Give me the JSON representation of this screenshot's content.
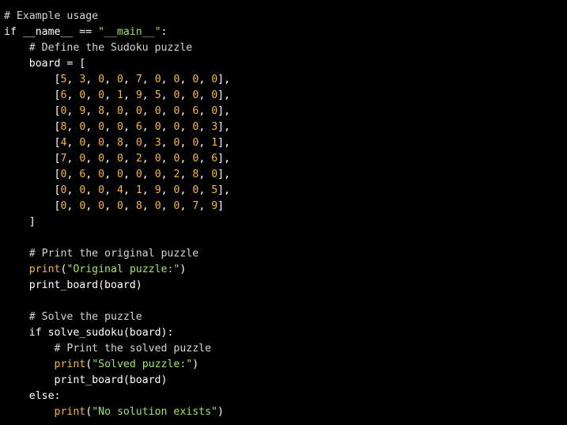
{
  "theme": {
    "background": "#000000",
    "comment": "#d4d4d4",
    "keyword": "#ffffff",
    "builtin": "#f5b83d",
    "string": "#9ee66a",
    "number": "#f5b83d",
    "plain": "#ffffff"
  },
  "code": {
    "lines": [
      [
        {
          "t": "comment",
          "v": "# Example usage"
        }
      ],
      [
        {
          "t": "keyword",
          "v": "if"
        },
        {
          "t": "plain",
          "v": " __name__ == "
        },
        {
          "t": "string",
          "v": "\"__main__\""
        },
        {
          "t": "plain",
          "v": ":"
        }
      ],
      [
        {
          "t": "plain",
          "v": "    "
        },
        {
          "t": "comment",
          "v": "# Define the Sudoku puzzle"
        }
      ],
      [
        {
          "t": "plain",
          "v": "    board = ["
        }
      ],
      [
        {
          "t": "plain",
          "v": "        ["
        },
        {
          "t": "number",
          "v": "5"
        },
        {
          "t": "plain",
          "v": ", "
        },
        {
          "t": "number",
          "v": "3"
        },
        {
          "t": "plain",
          "v": ", "
        },
        {
          "t": "number",
          "v": "0"
        },
        {
          "t": "plain",
          "v": ", "
        },
        {
          "t": "number",
          "v": "0"
        },
        {
          "t": "plain",
          "v": ", "
        },
        {
          "t": "number",
          "v": "7"
        },
        {
          "t": "plain",
          "v": ", "
        },
        {
          "t": "number",
          "v": "0"
        },
        {
          "t": "plain",
          "v": ", "
        },
        {
          "t": "number",
          "v": "0"
        },
        {
          "t": "plain",
          "v": ", "
        },
        {
          "t": "number",
          "v": "0"
        },
        {
          "t": "plain",
          "v": ", "
        },
        {
          "t": "number",
          "v": "0"
        },
        {
          "t": "plain",
          "v": "],"
        }
      ],
      [
        {
          "t": "plain",
          "v": "        ["
        },
        {
          "t": "number",
          "v": "6"
        },
        {
          "t": "plain",
          "v": ", "
        },
        {
          "t": "number",
          "v": "0"
        },
        {
          "t": "plain",
          "v": ", "
        },
        {
          "t": "number",
          "v": "0"
        },
        {
          "t": "plain",
          "v": ", "
        },
        {
          "t": "number",
          "v": "1"
        },
        {
          "t": "plain",
          "v": ", "
        },
        {
          "t": "number",
          "v": "9"
        },
        {
          "t": "plain",
          "v": ", "
        },
        {
          "t": "number",
          "v": "5"
        },
        {
          "t": "plain",
          "v": ", "
        },
        {
          "t": "number",
          "v": "0"
        },
        {
          "t": "plain",
          "v": ", "
        },
        {
          "t": "number",
          "v": "0"
        },
        {
          "t": "plain",
          "v": ", "
        },
        {
          "t": "number",
          "v": "0"
        },
        {
          "t": "plain",
          "v": "],"
        }
      ],
      [
        {
          "t": "plain",
          "v": "        ["
        },
        {
          "t": "number",
          "v": "0"
        },
        {
          "t": "plain",
          "v": ", "
        },
        {
          "t": "number",
          "v": "9"
        },
        {
          "t": "plain",
          "v": ", "
        },
        {
          "t": "number",
          "v": "8"
        },
        {
          "t": "plain",
          "v": ", "
        },
        {
          "t": "number",
          "v": "0"
        },
        {
          "t": "plain",
          "v": ", "
        },
        {
          "t": "number",
          "v": "0"
        },
        {
          "t": "plain",
          "v": ", "
        },
        {
          "t": "number",
          "v": "0"
        },
        {
          "t": "plain",
          "v": ", "
        },
        {
          "t": "number",
          "v": "0"
        },
        {
          "t": "plain",
          "v": ", "
        },
        {
          "t": "number",
          "v": "6"
        },
        {
          "t": "plain",
          "v": ", "
        },
        {
          "t": "number",
          "v": "0"
        },
        {
          "t": "plain",
          "v": "],"
        }
      ],
      [
        {
          "t": "plain",
          "v": "        ["
        },
        {
          "t": "number",
          "v": "8"
        },
        {
          "t": "plain",
          "v": ", "
        },
        {
          "t": "number",
          "v": "0"
        },
        {
          "t": "plain",
          "v": ", "
        },
        {
          "t": "number",
          "v": "0"
        },
        {
          "t": "plain",
          "v": ", "
        },
        {
          "t": "number",
          "v": "0"
        },
        {
          "t": "plain",
          "v": ", "
        },
        {
          "t": "number",
          "v": "6"
        },
        {
          "t": "plain",
          "v": ", "
        },
        {
          "t": "number",
          "v": "0"
        },
        {
          "t": "plain",
          "v": ", "
        },
        {
          "t": "number",
          "v": "0"
        },
        {
          "t": "plain",
          "v": ", "
        },
        {
          "t": "number",
          "v": "0"
        },
        {
          "t": "plain",
          "v": ", "
        },
        {
          "t": "number",
          "v": "3"
        },
        {
          "t": "plain",
          "v": "],"
        }
      ],
      [
        {
          "t": "plain",
          "v": "        ["
        },
        {
          "t": "number",
          "v": "4"
        },
        {
          "t": "plain",
          "v": ", "
        },
        {
          "t": "number",
          "v": "0"
        },
        {
          "t": "plain",
          "v": ", "
        },
        {
          "t": "number",
          "v": "0"
        },
        {
          "t": "plain",
          "v": ", "
        },
        {
          "t": "number",
          "v": "8"
        },
        {
          "t": "plain",
          "v": ", "
        },
        {
          "t": "number",
          "v": "0"
        },
        {
          "t": "plain",
          "v": ", "
        },
        {
          "t": "number",
          "v": "3"
        },
        {
          "t": "plain",
          "v": ", "
        },
        {
          "t": "number",
          "v": "0"
        },
        {
          "t": "plain",
          "v": ", "
        },
        {
          "t": "number",
          "v": "0"
        },
        {
          "t": "plain",
          "v": ", "
        },
        {
          "t": "number",
          "v": "1"
        },
        {
          "t": "plain",
          "v": "],"
        }
      ],
      [
        {
          "t": "plain",
          "v": "        ["
        },
        {
          "t": "number",
          "v": "7"
        },
        {
          "t": "plain",
          "v": ", "
        },
        {
          "t": "number",
          "v": "0"
        },
        {
          "t": "plain",
          "v": ", "
        },
        {
          "t": "number",
          "v": "0"
        },
        {
          "t": "plain",
          "v": ", "
        },
        {
          "t": "number",
          "v": "0"
        },
        {
          "t": "plain",
          "v": ", "
        },
        {
          "t": "number",
          "v": "2"
        },
        {
          "t": "plain",
          "v": ", "
        },
        {
          "t": "number",
          "v": "0"
        },
        {
          "t": "plain",
          "v": ", "
        },
        {
          "t": "number",
          "v": "0"
        },
        {
          "t": "plain",
          "v": ", "
        },
        {
          "t": "number",
          "v": "0"
        },
        {
          "t": "plain",
          "v": ", "
        },
        {
          "t": "number",
          "v": "6"
        },
        {
          "t": "plain",
          "v": "],"
        }
      ],
      [
        {
          "t": "plain",
          "v": "        ["
        },
        {
          "t": "number",
          "v": "0"
        },
        {
          "t": "plain",
          "v": ", "
        },
        {
          "t": "number",
          "v": "6"
        },
        {
          "t": "plain",
          "v": ", "
        },
        {
          "t": "number",
          "v": "0"
        },
        {
          "t": "plain",
          "v": ", "
        },
        {
          "t": "number",
          "v": "0"
        },
        {
          "t": "plain",
          "v": ", "
        },
        {
          "t": "number",
          "v": "0"
        },
        {
          "t": "plain",
          "v": ", "
        },
        {
          "t": "number",
          "v": "0"
        },
        {
          "t": "plain",
          "v": ", "
        },
        {
          "t": "number",
          "v": "2"
        },
        {
          "t": "plain",
          "v": ", "
        },
        {
          "t": "number",
          "v": "8"
        },
        {
          "t": "plain",
          "v": ", "
        },
        {
          "t": "number",
          "v": "0"
        },
        {
          "t": "plain",
          "v": "],"
        }
      ],
      [
        {
          "t": "plain",
          "v": "        ["
        },
        {
          "t": "number",
          "v": "0"
        },
        {
          "t": "plain",
          "v": ", "
        },
        {
          "t": "number",
          "v": "0"
        },
        {
          "t": "plain",
          "v": ", "
        },
        {
          "t": "number",
          "v": "0"
        },
        {
          "t": "plain",
          "v": ", "
        },
        {
          "t": "number",
          "v": "4"
        },
        {
          "t": "plain",
          "v": ", "
        },
        {
          "t": "number",
          "v": "1"
        },
        {
          "t": "plain",
          "v": ", "
        },
        {
          "t": "number",
          "v": "9"
        },
        {
          "t": "plain",
          "v": ", "
        },
        {
          "t": "number",
          "v": "0"
        },
        {
          "t": "plain",
          "v": ", "
        },
        {
          "t": "number",
          "v": "0"
        },
        {
          "t": "plain",
          "v": ", "
        },
        {
          "t": "number",
          "v": "5"
        },
        {
          "t": "plain",
          "v": "],"
        }
      ],
      [
        {
          "t": "plain",
          "v": "        ["
        },
        {
          "t": "number",
          "v": "0"
        },
        {
          "t": "plain",
          "v": ", "
        },
        {
          "t": "number",
          "v": "0"
        },
        {
          "t": "plain",
          "v": ", "
        },
        {
          "t": "number",
          "v": "0"
        },
        {
          "t": "plain",
          "v": ", "
        },
        {
          "t": "number",
          "v": "0"
        },
        {
          "t": "plain",
          "v": ", "
        },
        {
          "t": "number",
          "v": "8"
        },
        {
          "t": "plain",
          "v": ", "
        },
        {
          "t": "number",
          "v": "0"
        },
        {
          "t": "plain",
          "v": ", "
        },
        {
          "t": "number",
          "v": "0"
        },
        {
          "t": "plain",
          "v": ", "
        },
        {
          "t": "number",
          "v": "7"
        },
        {
          "t": "plain",
          "v": ", "
        },
        {
          "t": "number",
          "v": "9"
        },
        {
          "t": "plain",
          "v": "]"
        }
      ],
      [
        {
          "t": "plain",
          "v": "    ]"
        }
      ],
      [],
      [
        {
          "t": "plain",
          "v": "    "
        },
        {
          "t": "comment",
          "v": "# Print the original puzzle"
        }
      ],
      [
        {
          "t": "plain",
          "v": "    "
        },
        {
          "t": "builtin",
          "v": "print"
        },
        {
          "t": "plain",
          "v": "("
        },
        {
          "t": "string",
          "v": "\"Original puzzle:\""
        },
        {
          "t": "plain",
          "v": ")"
        }
      ],
      [
        {
          "t": "plain",
          "v": "    print_board(board)"
        }
      ],
      [],
      [
        {
          "t": "plain",
          "v": "    "
        },
        {
          "t": "comment",
          "v": "# Solve the puzzle"
        }
      ],
      [
        {
          "t": "plain",
          "v": "    "
        },
        {
          "t": "keyword",
          "v": "if"
        },
        {
          "t": "plain",
          "v": " solve_sudoku(board):"
        }
      ],
      [
        {
          "t": "plain",
          "v": "        "
        },
        {
          "t": "comment",
          "v": "# Print the solved puzzle"
        }
      ],
      [
        {
          "t": "plain",
          "v": "        "
        },
        {
          "t": "builtin",
          "v": "print"
        },
        {
          "t": "plain",
          "v": "("
        },
        {
          "t": "string",
          "v": "\"Solved puzzle:\""
        },
        {
          "t": "plain",
          "v": ")"
        }
      ],
      [
        {
          "t": "plain",
          "v": "        print_board(board)"
        }
      ],
      [
        {
          "t": "plain",
          "v": "    "
        },
        {
          "t": "keyword",
          "v": "else"
        },
        {
          "t": "plain",
          "v": ":"
        }
      ],
      [
        {
          "t": "plain",
          "v": "        "
        },
        {
          "t": "builtin",
          "v": "print"
        },
        {
          "t": "plain",
          "v": "("
        },
        {
          "t": "string",
          "v": "\"No solution exists\""
        },
        {
          "t": "plain",
          "v": ")"
        }
      ]
    ]
  }
}
